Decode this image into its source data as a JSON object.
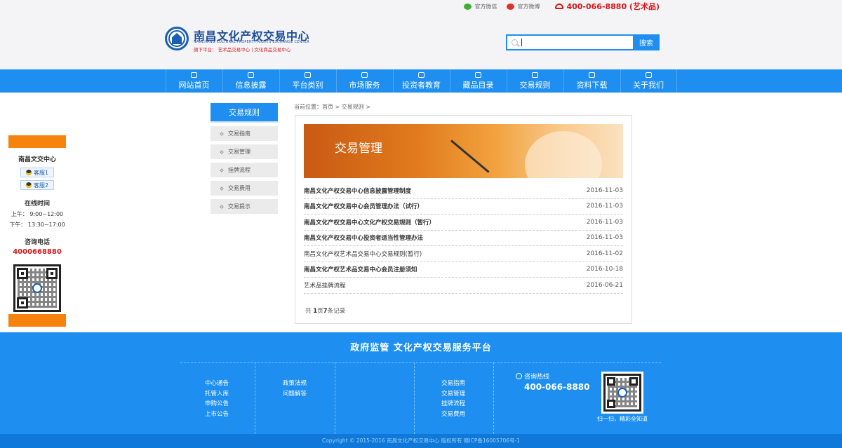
{
  "topbar": {
    "wechat": "官方微信",
    "weibo": "官方微博",
    "phone": "400-066-8880 (艺术品)"
  },
  "brand": {
    "name_cn": "南昌文化产权交易中心",
    "name_en": "NANCHANG CULTURAL PROPERTY RIGHTS EXCHANGE CENTER",
    "sub": "旗下平台： 艺术品交易中心 | 文化商品交易中心"
  },
  "search": {
    "placeholder": "",
    "button": "搜索"
  },
  "nav": [
    "网站首页",
    "信息披露",
    "平台类别",
    "市场服务",
    "投资者教育",
    "藏品目录",
    "交易规则",
    "资料下载",
    "关于我们"
  ],
  "left_sidebar": {
    "title": "南昌文交中心",
    "qq1": "客服1",
    "qq2": "客服2",
    "online_title": "在线时间",
    "am": "上午：  9:00~12:00",
    "pm": "下午：  13:30~17:00",
    "consult_title": "咨询电话",
    "consult_phone": "4000668880"
  },
  "category": {
    "title": "交易规则",
    "items": [
      "交易指南",
      "交易管理",
      "挂牌流程",
      "交易费用",
      "交易提示"
    ]
  },
  "breadcrumb": "当前位置：首页 > 交易规则 >",
  "banner_title": "交易管理",
  "articles": [
    {
      "title": "南昌文化产权交易中心信息披露管理制度",
      "date": "2016-11-03",
      "bold": true
    },
    {
      "title": "南昌文化产权交易中心会员管理办法（试行）",
      "date": "2016-11-03",
      "bold": true
    },
    {
      "title": "南昌文化产权交易中心文化产权交易规则（暂行）",
      "date": "2016-11-03",
      "bold": true
    },
    {
      "title": "南昌文化产权交易中心投资者适当性管理办法",
      "date": "2016-11-03",
      "bold": true
    },
    {
      "title": "南昌文化产权艺术品交易中心交易规则(暂行)",
      "date": "2016-11-02",
      "bold": false
    },
    {
      "title": "南昌文化产权艺术品交易中心会员注册须知",
      "date": "2016-10-18",
      "bold": true
    },
    {
      "title": "艺术品挂牌流程",
      "date": "2016-06-21",
      "bold": false
    }
  ],
  "pager": {
    "pre": "共 ",
    "pages": "1",
    "mid": "页",
    "count": "7",
    "post": "条记录"
  },
  "footer": {
    "title": "政府监管  文化产权交易服务平台",
    "col1": [
      "中心通告",
      "托管入库",
      "申购公告",
      "上市公告"
    ],
    "col2": [
      "政策法规",
      "问题解答"
    ],
    "col3": [
      "交易指南",
      "交易管理",
      "挂牌流程",
      "交易费用"
    ],
    "hotline_label": "咨询热线",
    "hotline": "400-066-8880",
    "qr_caption": "扫一扫，精彩全知道"
  },
  "copyright": "Copyright © 2015-2016 南昌文化产权交易中心 版权所有 赣ICP备16005706号-1",
  "colors": {
    "primary": "#1e8ff0",
    "accent": "#f7830f",
    "alert": "#d8161b"
  }
}
